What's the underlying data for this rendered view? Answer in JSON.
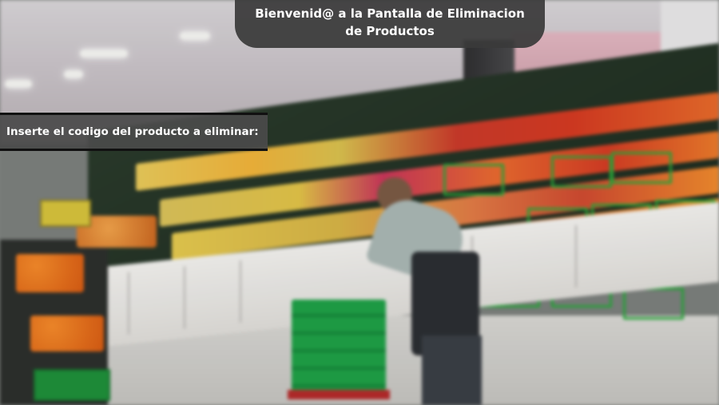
{
  "window": {
    "title": "Bienvenid@ a la Pantalla de Eliminacion de Productos"
  },
  "prompt": {
    "label": "Inserte el codigo del producto a eliminar:"
  },
  "background": {
    "description_icon": "supermarket-produce-photo"
  },
  "colors": {
    "banner": "#3a3a3a",
    "text": "#ffffff",
    "accent_green": "#28a63a"
  }
}
